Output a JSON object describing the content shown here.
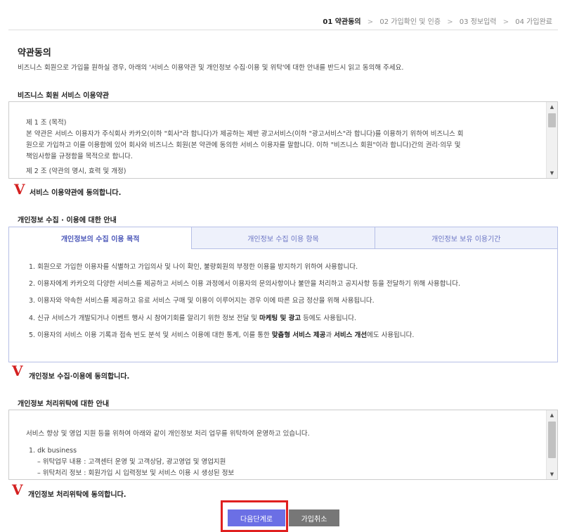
{
  "steps": [
    {
      "label": "01 약관동의",
      "active": true
    },
    {
      "label": "02 가입확인 및 인증",
      "active": false
    },
    {
      "label": "03 정보입력",
      "active": false
    },
    {
      "label": "04 가입완료",
      "active": false
    }
  ],
  "step_separator": ">",
  "page": {
    "title": "약관동의",
    "description": "비즈니스 회원으로 가입을 원하실 경우, 아래의 '서비스 이용약관 및 개인정보 수집·이용 및 위탁'에 대한 안내를 반드시 읽고 동의해 주세요."
  },
  "terms": {
    "title": "비즈니스 회원 서비스 이용약관",
    "lines": [
      "제 1 조 (목적)",
      "본 약관은 서비스 이용자가 주식회사 카카오(이하 \"회사\"라 합니다)가 제공하는 제반 광고서비스(이하 \"광고서비스\"라 합니다)를 이용하기 위하여 비즈니스 회",
      "원으로 가입하고 이를 이용함에 있어 회사와 비즈니스 회원(본 약관에 동의한 서비스 이용자를 말합니다. 이하 \"비즈니스 회원\"이라 합니다)간의 권리·의무 및",
      "책임사항을 규정함을 목적으로 합니다.",
      "제 2 조 (약관의 명시, 효력 및 개정)"
    ],
    "agree_label": "서비스 이용약관에 동의합니다."
  },
  "privacy": {
    "title": "개인정보 수집 · 이용에 대한 안내",
    "tabs": [
      {
        "label": "개인정보의 수집 이용 목적",
        "active": true
      },
      {
        "label": "개인정보 수집 이용 항목",
        "active": false
      },
      {
        "label": "개인정보 보유 이용기간",
        "active": false
      }
    ],
    "items": [
      {
        "pre": "1. 회원으로 가입한 이용자를 식별하고 가입의사 및 나이 확인, 불량회원의 부정한 이용을 방지하기 위하여 사용합니다.",
        "bold": "",
        "mid": "",
        "bold2": "",
        "post": ""
      },
      {
        "pre": "2. 이용자에게 카카오의 다양한 서비스를 제공하고 서비스 이용 과정에서 이용자의 문의사항이나 불만을 처리하고 공지사항 등을 전달하기 위해 사용합니다.",
        "bold": "",
        "mid": "",
        "bold2": "",
        "post": ""
      },
      {
        "pre": "3. 이용자와 약속한 서비스를 제공하고 유료 서비스 구매 및 이용이 이루어지는 경우 이에 따른 요금 정산을 위해 사용됩니다.",
        "bold": "",
        "mid": "",
        "bold2": "",
        "post": ""
      },
      {
        "pre": "4. 신규 서비스가 개발되거나 이벤트 행사 시 참여기회를 알리기 위한 정보 전달 및 ",
        "bold": "마케팅 및 광고",
        "mid": " 등에도 사용됩니다.",
        "bold2": "",
        "post": ""
      },
      {
        "pre": "5. 이용자의 서비스 이용 기록과 접속 빈도 분석 및 서비스 이용에 대한 통계, 이를 통한 ",
        "bold": "맞춤형 서비스 제공",
        "mid": "과 ",
        "bold2": "서비스 개선",
        "post": "에도 사용됩니다."
      }
    ],
    "agree_label": "개인정보 수집·이용에 동의합니다."
  },
  "consignment": {
    "title": "개인정보 처리위탁에 대한 안내",
    "lines": [
      "서비스 향상 및 영업 지원 등을 위하여 아래와 같이 개인정보 처리 업무를 위탁하여 운영하고 있습니다.",
      "1. dk business",
      "– 위탁업무 내용 : 고객센터 운영 및 고객상담, 광고영업 및 영업지원",
      "– 위탁처리 정보 : 회원가입 시 입력정보 및 서비스 이용 시 생성된 정보"
    ],
    "agree_label": "개인정보 처리위탁에 동의합니다."
  },
  "buttons": {
    "next": "다음단계로",
    "cancel": "가입취소"
  },
  "check_mark": "V",
  "scroll_up": "▲",
  "scroll_down": "▼",
  "colors": {
    "accent": "#6b6fe5",
    "check_mark": "#d42020",
    "highlight": "#e02020",
    "tab_border": "#b6bfe6"
  }
}
